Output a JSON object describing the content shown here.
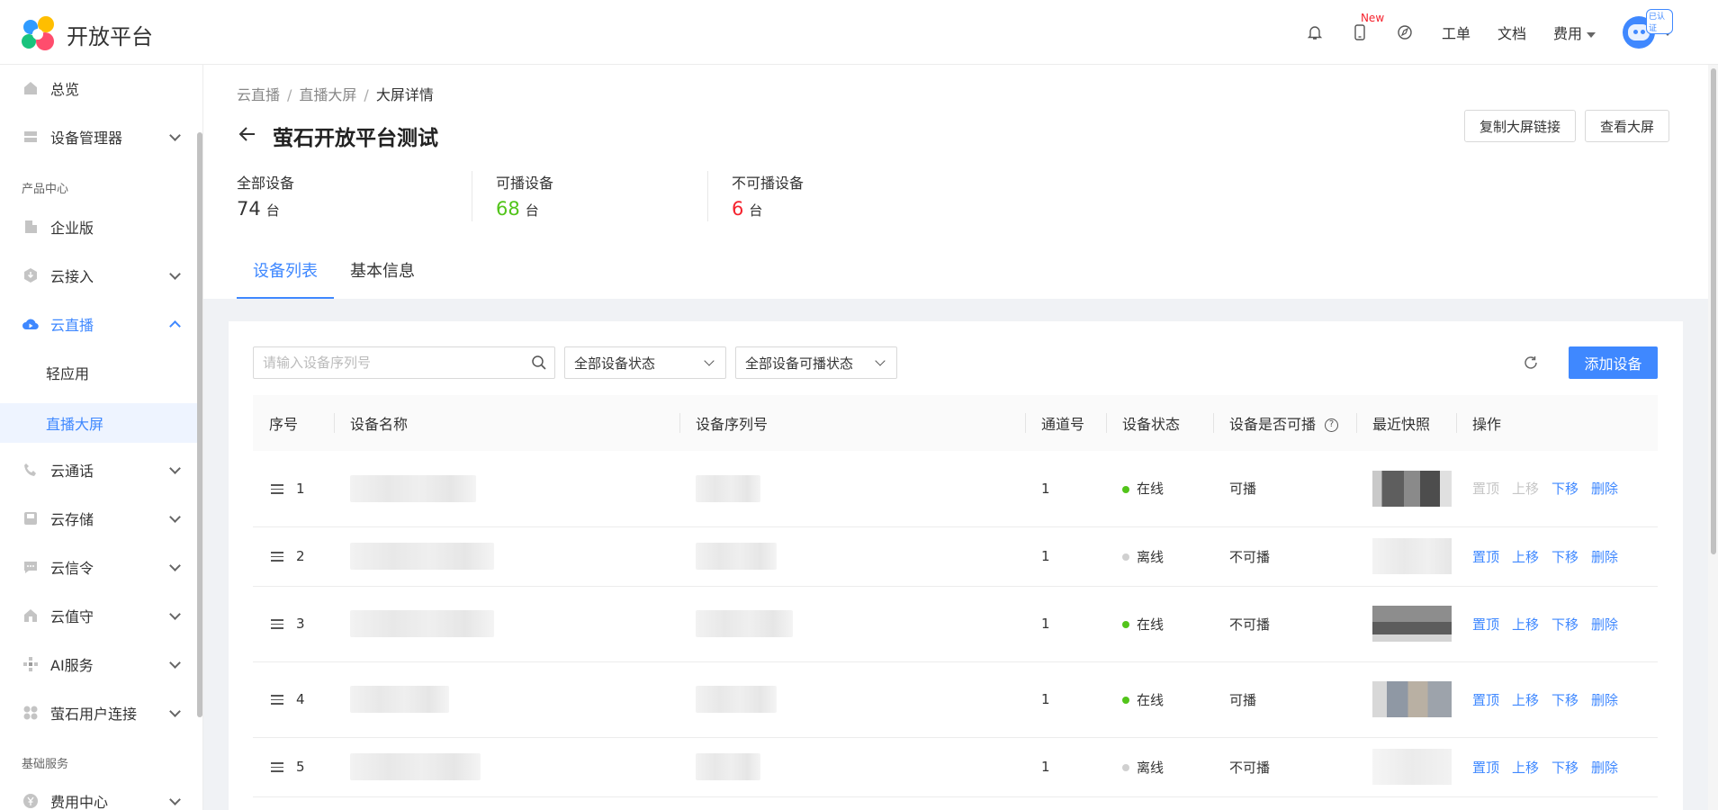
{
  "header": {
    "logo_text": "开放平台",
    "new_badge": "New",
    "links": [
      "工单",
      "文档"
    ],
    "billing_label": "费用",
    "verified_badge": "已认证"
  },
  "sidebar": {
    "items": [
      {
        "label": "总览",
        "icon": "home-icon"
      },
      {
        "label": "设备管理器",
        "icon": "device-icon"
      },
      {
        "label": "企业版",
        "icon": "building-icon"
      },
      {
        "label": "云接入",
        "icon": "cloud-in-icon"
      },
      {
        "label": "云直播",
        "icon": "cloud-live-icon"
      },
      {
        "label": "轻应用"
      },
      {
        "label": "直播大屏"
      },
      {
        "label": "云通话",
        "icon": "phone-icon"
      },
      {
        "label": "云存储",
        "icon": "storage-icon"
      },
      {
        "label": "云信令",
        "icon": "message-icon"
      },
      {
        "label": "云值守",
        "icon": "guard-icon"
      },
      {
        "label": "AI服务",
        "icon": "ai-icon"
      },
      {
        "label": "萤石用户连接",
        "icon": "connect-icon"
      },
      {
        "label": "费用中心",
        "icon": "yen-icon"
      }
    ],
    "groups": [
      "产品中心",
      "基础服务"
    ]
  },
  "page": {
    "breadcrumb": [
      "云直播",
      "直播大屏",
      "大屏详情"
    ],
    "title": "萤石开放平台测试",
    "copy_link_label": "复制大屏链接",
    "view_screen_label": "查看大屏",
    "stats": [
      {
        "label": "全部设备",
        "value": "74",
        "unit": "台"
      },
      {
        "label": "可播设备",
        "value": "68",
        "unit": "台"
      },
      {
        "label": "不可播设备",
        "value": "6",
        "unit": "台"
      }
    ],
    "tabs": [
      "设备列表",
      "基本信息"
    ]
  },
  "toolbar": {
    "search_placeholder": "请输入设备序列号",
    "status_filter": "全部设备状态",
    "playable_filter": "全部设备可播状态",
    "add_label": "添加设备"
  },
  "table": {
    "columns": [
      "序号",
      "设备名称",
      "设备序列号",
      "通道号",
      "设备状态",
      "设备是否可播",
      "最近快照",
      "操作"
    ],
    "actions": [
      "置顶",
      "上移",
      "下移",
      "删除"
    ],
    "rows": [
      {
        "index": "1",
        "channel": "1",
        "status": "在线",
        "online": true,
        "playable": "可播"
      },
      {
        "index": "2",
        "channel": "1",
        "status": "离线",
        "online": false,
        "playable": "不可播"
      },
      {
        "index": "3",
        "channel": "1",
        "status": "在线",
        "online": true,
        "playable": "不可播"
      },
      {
        "index": "4",
        "channel": "1",
        "status": "在线",
        "online": true,
        "playable": "可播"
      },
      {
        "index": "5",
        "channel": "1",
        "status": "离线",
        "online": false,
        "playable": "不可播"
      }
    ]
  },
  "colors": {
    "accent": "#3f88ff",
    "online": "#52c41a",
    "danger": "#f5222d"
  }
}
